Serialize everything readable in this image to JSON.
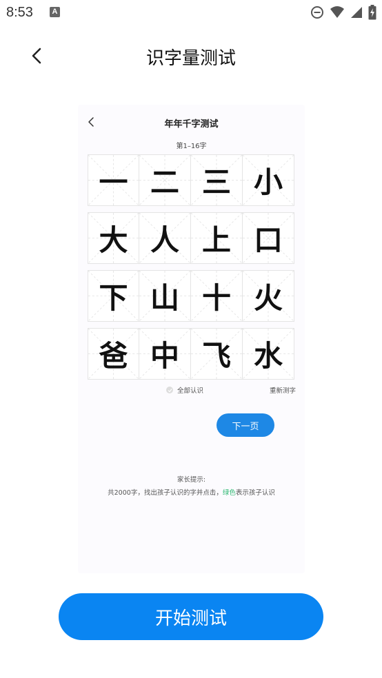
{
  "status_bar": {
    "time": "8:53",
    "notification_icon": "a-icon",
    "icons": [
      "do-not-disturb-icon",
      "wifi-icon",
      "signal-icon",
      "battery-charging-icon"
    ]
  },
  "nav": {
    "back_icon": "chevron-left-icon",
    "title": "识字量测试"
  },
  "preview": {
    "back_icon": "chevron-left-icon",
    "title": "年年千字测试",
    "subtitle": "第1–16字",
    "characters": [
      [
        "一",
        "二",
        "三",
        "小"
      ],
      [
        "大",
        "人",
        "上",
        "口"
      ],
      [
        "下",
        "山",
        "十",
        "火"
      ],
      [
        "爸",
        "中",
        "飞",
        "水"
      ]
    ],
    "all_known_label": "全部认识",
    "retest_label": "重新测字",
    "next_label": "下一页",
    "hint_title": "家长提示:",
    "hint_before": "共2000字，找出孩子认识的字并点击，",
    "hint_green": "绿色",
    "hint_after": "表示孩子认识"
  },
  "start_button": "开始测试",
  "colors": {
    "primary_blue": "#0a85f2",
    "next_blue": "#1e88e5",
    "hint_green": "#2fb873"
  }
}
